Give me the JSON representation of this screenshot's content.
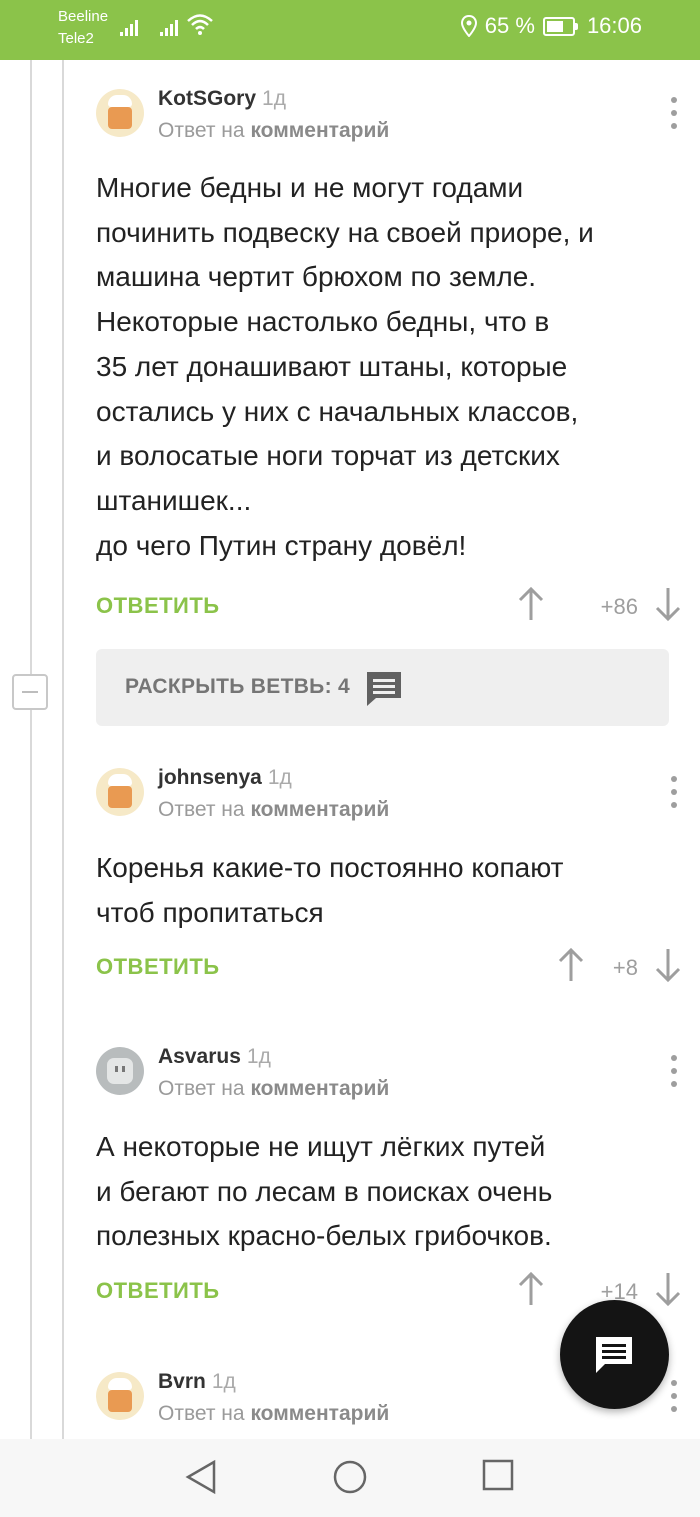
{
  "status_bar": {
    "carrier_1": "Beeline",
    "carrier_2": "Tele2",
    "battery_percent": "65 %",
    "battery_level": 0.65,
    "time": "16:06"
  },
  "comments": [
    {
      "username": "KotSGory",
      "date": "1д",
      "reply_prefix": "Ответ на",
      "reply_target": "комментарий",
      "text": "Многие бедны и не могут годами\nпочинить подвеску на своей приоре, и\nмашина чертит брюхом по земле.\nНекоторые настолько бедны, что в\n35 лет донашивают штаны, которые\nостались у них с начальных классов,\nи волосатые ноги торчат из детских\nштанишек...\nдо чего Путин страну довёл!",
      "reply_label": "ОТВЕТИТЬ",
      "score": "+86",
      "avatar_icon": "chef-avatar-icon"
    },
    {
      "username": "johnsenya",
      "date": "1д",
      "reply_prefix": "Ответ на",
      "reply_target": "комментарий",
      "text": "Коренья какие-то постоянно копают\nчтоб пропитаться",
      "reply_label": "ОТВЕТИТЬ",
      "score": "+8",
      "avatar_icon": "chef-avatar-icon"
    },
    {
      "username": "Asvarus",
      "date": "1д",
      "reply_prefix": "Ответ на",
      "reply_target": "комментарий",
      "text": "А некоторые не ищут лёгких путей\nи бегают по лесам в поисках очень\nполезных красно-белых грибочков.",
      "reply_label": "ОТВЕТИТЬ",
      "score": "+14",
      "avatar_icon": "socket-avatar-icon"
    },
    {
      "username": "Bvrn",
      "date": "1д",
      "reply_prefix": "Ответ на",
      "reply_target": "комментарий",
      "avatar_icon": "chef-avatar-icon"
    }
  ],
  "branch": {
    "label": "РАСКРЫТЬ ВЕТВЬ: 4"
  },
  "colors": {
    "accent_green": "#8bc34a",
    "fab": "#141414"
  }
}
